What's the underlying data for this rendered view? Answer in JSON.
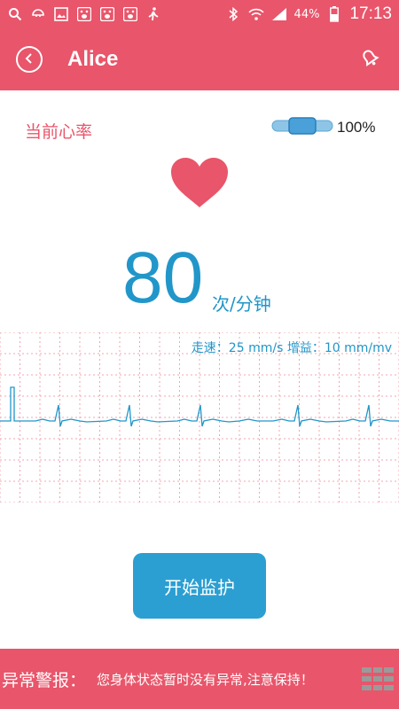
{
  "status_bar": {
    "left_icons": [
      "search-icon",
      "baby-icon",
      "gallery-icon",
      "paw-app-icon",
      "paw-app-icon",
      "paw-app-icon",
      "walk-icon"
    ],
    "battery_percent": "44%",
    "time": "17:13"
  },
  "app_bar": {
    "title": "Alice",
    "back_icon": "back-circle-icon",
    "alarm_icon": "alarm-bell-icon"
  },
  "heart_rate": {
    "label": "当前心率",
    "device_battery": "100%",
    "value": "80",
    "unit": "次/分钟"
  },
  "ecg": {
    "meta": "走速：25 mm/s 增益：10 mm/mv"
  },
  "actions": {
    "start_label": "开始监护"
  },
  "alert": {
    "title": "异常警报：",
    "message": "您身体状态暂时没有异常,注意保持！",
    "menu_icon": "menu-grid-icon"
  },
  "colors": {
    "primary": "#e9556a",
    "accent": "#2196c9",
    "button": "#2c9fd2"
  }
}
